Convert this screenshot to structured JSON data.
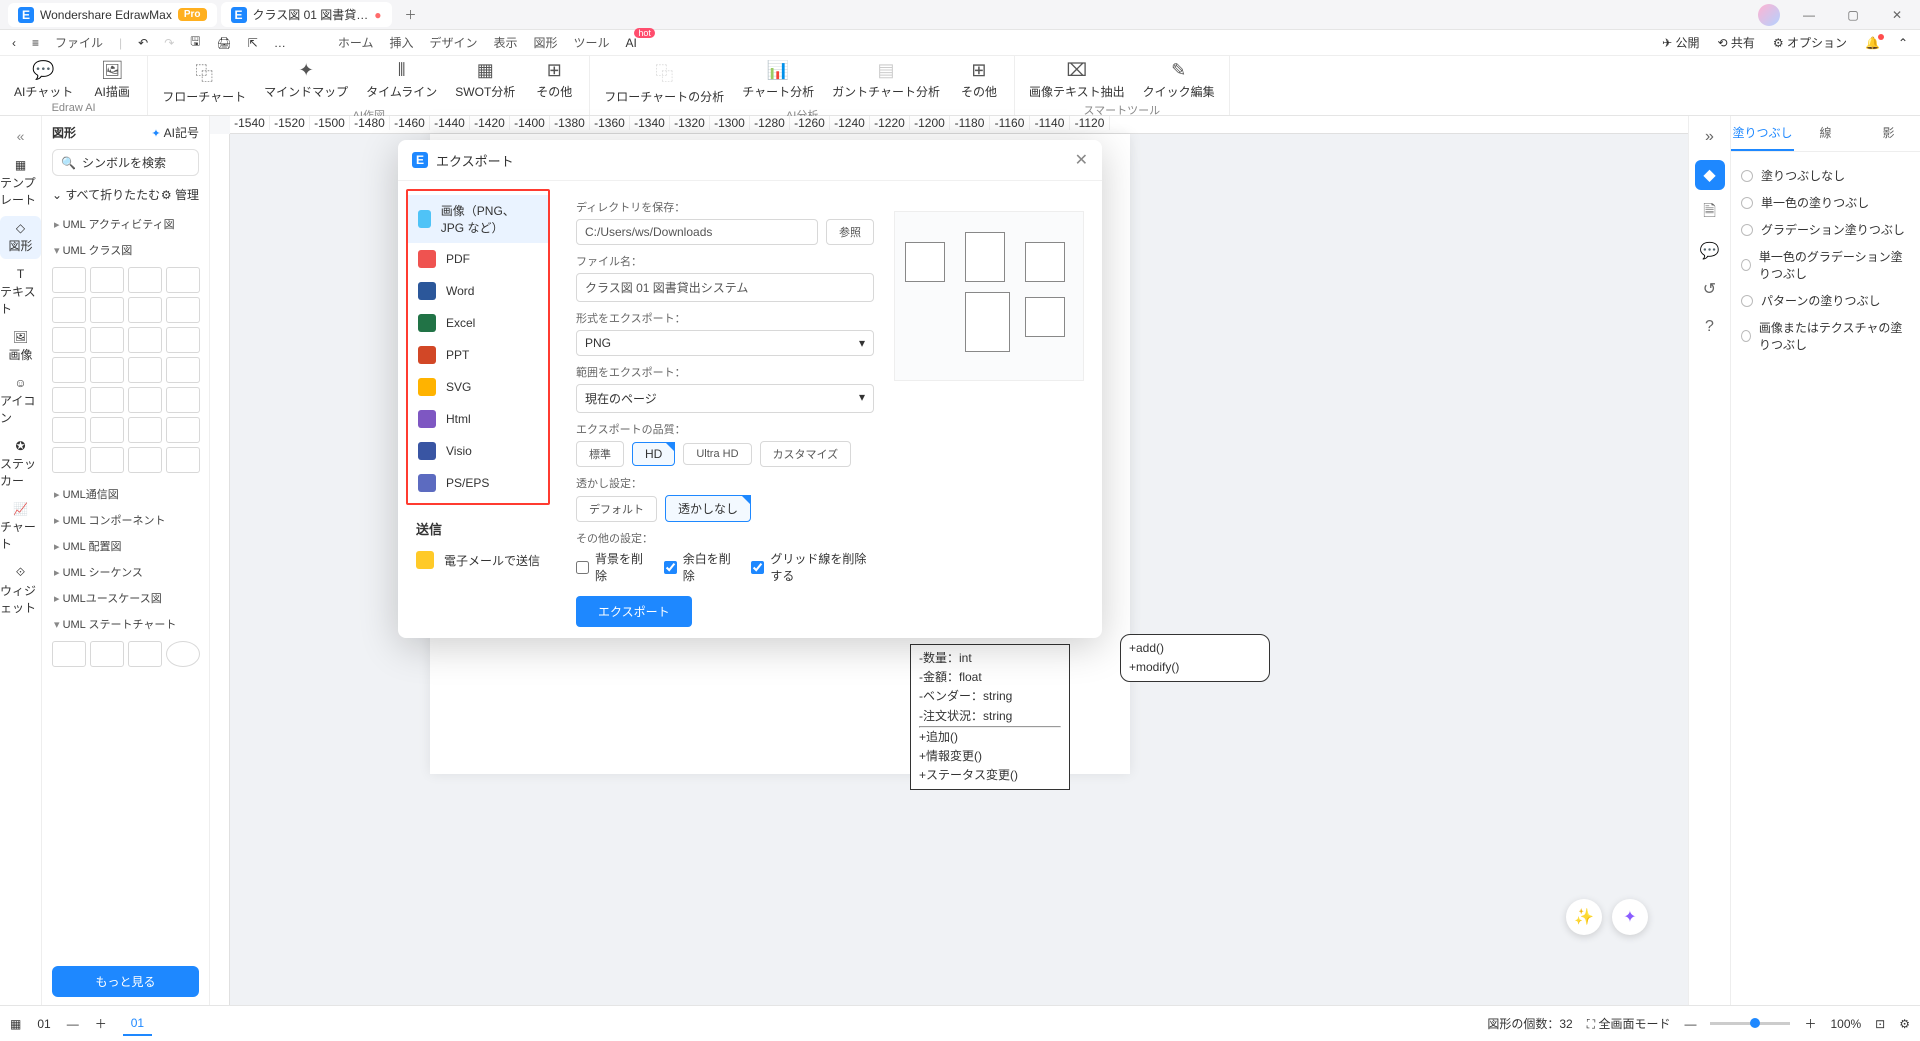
{
  "titlebar": {
    "app_name": "Wondershare EdrawMax",
    "pro": "Pro",
    "tab2": "クラス図 01 図書貸…"
  },
  "menu": {
    "file": "ファイル",
    "home": "ホーム",
    "insert": "挿入",
    "design": "デザイン",
    "display": "表示",
    "shape": "図形",
    "tool": "ツール",
    "ai": "AI",
    "hot": "hot",
    "publish": "公開",
    "share": "共有",
    "options": "オプション"
  },
  "ribbon": {
    "g1": {
      "label": "Edraw AI",
      "ai_chat": "AIチャット",
      "ai_draw": "AI描画"
    },
    "g2": {
      "label": "AI作図",
      "flow": "フローチャート",
      "mind": "マインドマップ",
      "timeline": "タイムライン",
      "swot": "SWOT分析",
      "other": "その他"
    },
    "g3": {
      "label": "AI分析",
      "flowa": "フローチャートの分析",
      "charta": "チャート分析",
      "gantta": "ガントチャート分析",
      "other2": "その他"
    },
    "g4": {
      "label": "スマートツール",
      "imgtext": "画像テキスト抽出",
      "quick": "クイック編集"
    }
  },
  "lrail": {
    "template": "テンプレート",
    "shape": "図形",
    "text": "テキスト",
    "image": "画像",
    "icon": "アイコン",
    "sticker": "ステッカー",
    "chart": "チャート",
    "widget": "ウィジェット"
  },
  "shapes": {
    "title": "図形",
    "ai": "AI記号",
    "search_ph": "シンボルを検索",
    "fold": "すべて折りたたむ",
    "manage": "管理",
    "tree": [
      "UML アクティビティ図",
      "UML クラス図",
      "UML通信図",
      "UML コンポーネント",
      "UML 配置図",
      "UML シーケンス",
      "UMLユースケース図",
      "UML ステートチャート"
    ],
    "more": "もっと見る"
  },
  "canvas": {
    "box1": [
      "-数量：int",
      "-金額：float",
      "-ベンダー：string",
      "-注文状況：string",
      "",
      "+追加()",
      "+情報変更()",
      "+ステータス変更()"
    ],
    "box2": [
      "+add()",
      "+modify()"
    ]
  },
  "dialog": {
    "title": "エクスポート",
    "formats": [
      "画像（PNG、JPG など）",
      "PDF",
      "Word",
      "Excel",
      "PPT",
      "SVG",
      "Html",
      "Visio",
      "PS/EPS"
    ],
    "send": "送信",
    "email": "電子メールで送信",
    "dir_lbl": "ディレクトリを保存：",
    "dir": "C:/Users/ws/Downloads",
    "browse": "参照",
    "file_lbl": "ファイル名：",
    "file": "クラス図 01 図書貸出システム",
    "fmt_lbl": "形式をエクスポート：",
    "fmt": "PNG",
    "range_lbl": "範囲をエクスポート：",
    "range": "現在のページ",
    "quality_lbl": "エクスポートの品質：",
    "q1": "標準",
    "q2": "HD",
    "q3": "Ultra HD",
    "q4": "カスタマイズ",
    "wm_lbl": "透かし設定：",
    "wm1": "デフォルト",
    "wm2": "透かしなし",
    "other_lbl": "その他の設定：",
    "c1": "背景を削除",
    "c2": "余白を削除",
    "c3": "グリッド線を削除する",
    "export_btn": "エクスポート"
  },
  "rpanel": {
    "tabs": [
      "塗りつぶし",
      "線",
      "影"
    ],
    "opts": [
      "塗りつぶしなし",
      "単一色の塗りつぶし",
      "グラデーション塗りつぶし",
      "単一色のグラデーション塗りつぶし",
      "パターンの塗りつぶし",
      "画像またはテクスチャの塗りつぶし"
    ]
  },
  "status": {
    "page": "01",
    "pagetab": "01",
    "count_lbl": "図形の個数：",
    "count": "32",
    "fullscreen": "全画面モード",
    "zoom": "100%"
  }
}
